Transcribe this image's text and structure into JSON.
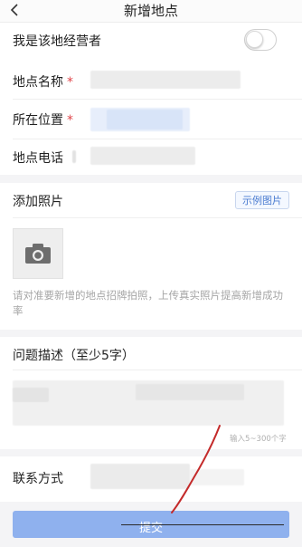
{
  "header": {
    "title": "新增地点",
    "back_icon": "chevron-left-icon"
  },
  "form": {
    "operator_label": "我是该地经营者",
    "operator_toggle_on": false,
    "name_label": "地点名称",
    "location_label": "所在位置",
    "phone_label": "地点电话",
    "required_mark": "*",
    "photo_label": "添加照片",
    "example_button": "示例图片",
    "photo_hint": "请对准要新增的地点招牌拍照，上传真实照片提高新增成功率",
    "issue_label": "问题描述（至少5字）",
    "char_counter": "输入5~300个字",
    "contact_label": "联系方式",
    "submit_label": "提交"
  },
  "colors": {
    "accent": "#4a7bd0",
    "required": "#e0454a",
    "submit_bg": "#8fb1ee"
  }
}
